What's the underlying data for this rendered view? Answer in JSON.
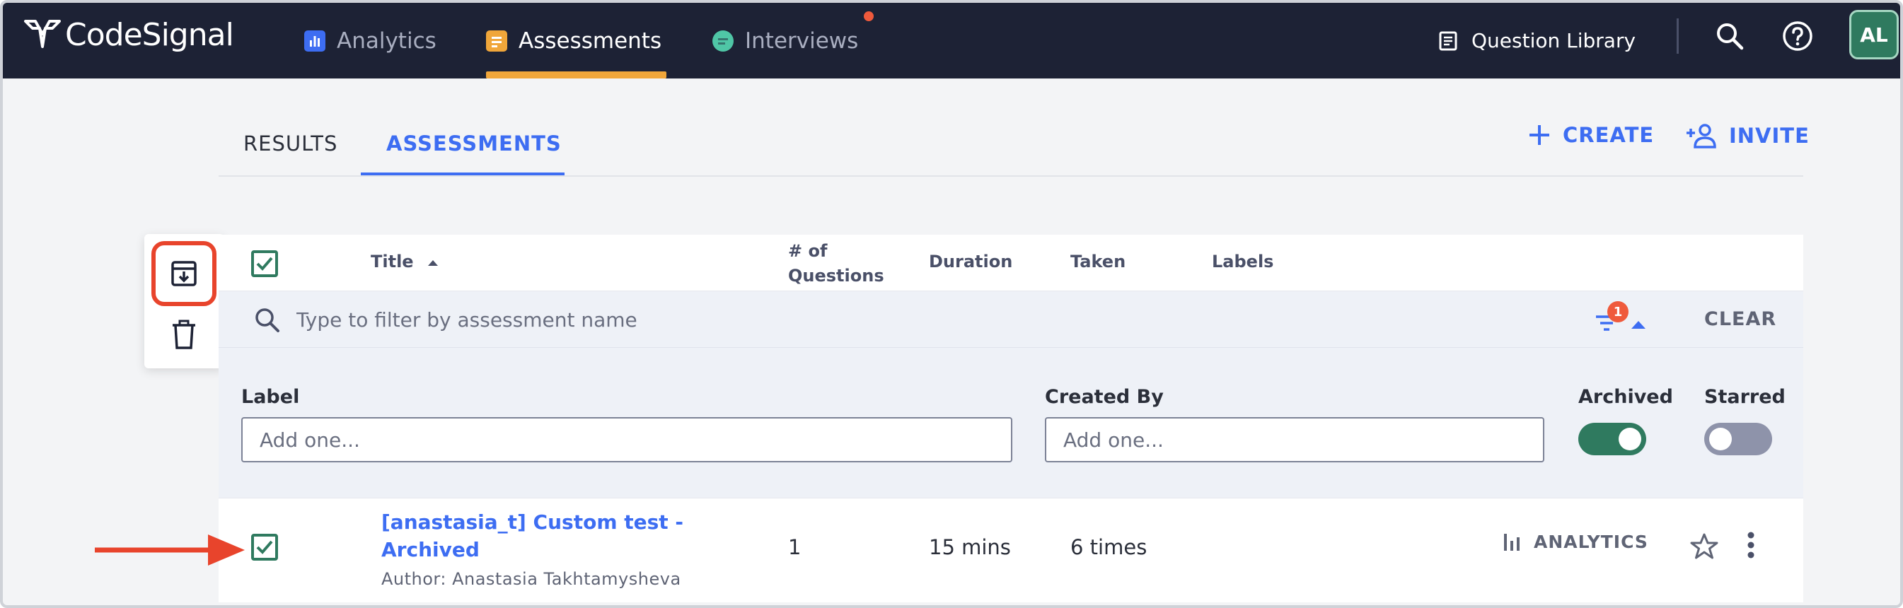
{
  "app": {
    "logo_text": "CodeSignal"
  },
  "nav": {
    "analytics": "Analytics",
    "assessments": "Assessments",
    "interviews": "Interviews",
    "question_library": "Question Library",
    "avatar_initials": "AL"
  },
  "subtabs": {
    "results": "RESULTS",
    "assessments": "ASSESSMENTS"
  },
  "actions": {
    "create": "CREATE",
    "invite": "INVITE"
  },
  "table": {
    "headers": {
      "title": "Title",
      "questions_line1": "# of",
      "questions_line2": "Questions",
      "duration": "Duration",
      "taken": "Taken",
      "labels": "Labels"
    },
    "filter": {
      "placeholder": "Type to filter by assessment name",
      "filter_count": "1",
      "clear": "CLEAR"
    },
    "filter_panel": {
      "label_heading": "Label",
      "label_placeholder": "Add one...",
      "created_by_heading": "Created By",
      "created_by_placeholder": "Add one...",
      "archived_heading": "Archived",
      "archived_on": true,
      "starred_heading": "Starred",
      "starred_on": false
    },
    "rows": [
      {
        "title": "[anastasia_t] Custom test - Archived",
        "author": "Author: Anastasia Takhtamysheva",
        "questions": "1",
        "duration": "15 mins",
        "taken": "6 times",
        "analytics": "ANALYTICS",
        "checked": true
      }
    ]
  },
  "colors": {
    "topbar": "#1d2235",
    "accent_blue": "#3d6df2",
    "accent_orange": "#f0a63a",
    "green": "#2f7a5f",
    "highlight_red": "#e8442c"
  }
}
